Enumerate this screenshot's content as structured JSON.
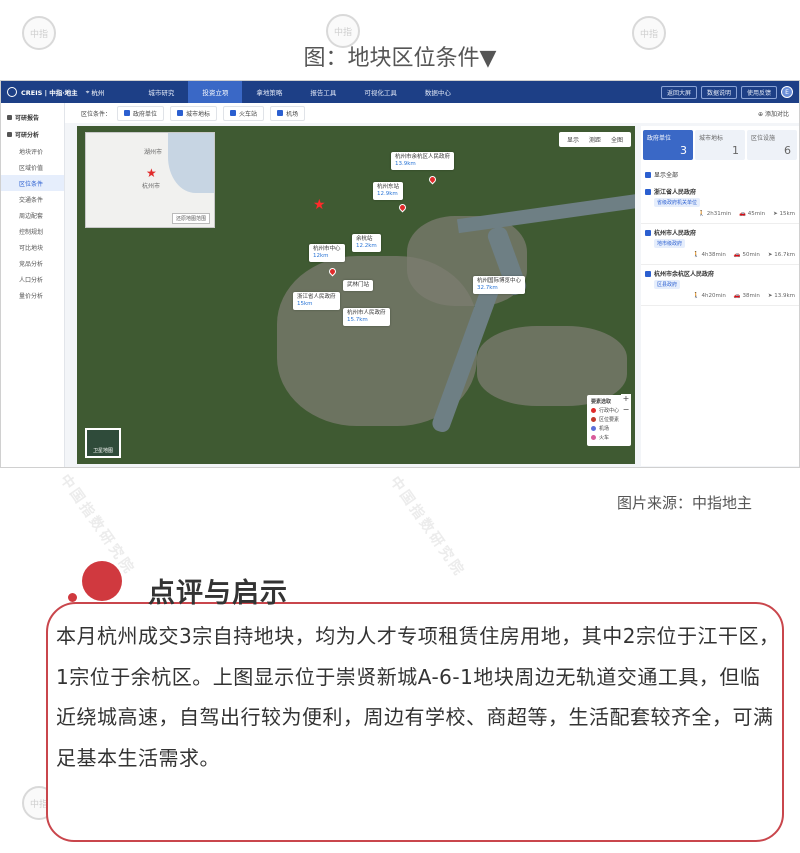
{
  "figure_title": "图：地块区位条件▼",
  "watermark": {
    "seal_text": "中指",
    "diagonal_text": "中国指数研究院"
  },
  "app": {
    "logo": "CREIS | 中指·地主",
    "city": "杭州",
    "nav": [
      "城市研究",
      "投资立项",
      "拿地策略",
      "报告工具",
      "可视化工具",
      "数据中心"
    ],
    "nav_active_index": 1,
    "top_buttons": [
      "返回大屏",
      "数据说明",
      "使用反馈"
    ],
    "avatar": "E",
    "sidebar": {
      "group1": "可研报告",
      "group2": "可研分析",
      "items": [
        "地块评价",
        "区域价值",
        "区位条件",
        "交通条件",
        "周边配套",
        "控制规划",
        "可比地块",
        "竞品分析",
        "人口分析",
        "量价分析"
      ],
      "active_index": 2
    },
    "filter": {
      "label": "区位条件：",
      "chips": [
        "政府单位",
        "城市地标",
        "火车站",
        "机场"
      ],
      "right": "添加对比"
    },
    "map": {
      "tools": [
        "显示",
        "测距",
        "全图"
      ],
      "inset": {
        "city_label": "杭州市",
        "north_label": "湖州市",
        "btn": "还原地图范围"
      },
      "pois": [
        {
          "name": "杭州市余杭区人民政府",
          "dist": "13.9km"
        },
        {
          "name": "杭州东站",
          "dist": "12.9km"
        },
        {
          "name": "余杭站",
          "dist": "12.2km"
        },
        {
          "name": "杭州市中心",
          "dist": "12km"
        },
        {
          "name": "杭州国际博览中心",
          "dist": "32.7km"
        },
        {
          "name": "浙江省人民政府",
          "dist": "15km"
        },
        {
          "name": "武林门站",
          "dist": ""
        },
        {
          "name": "杭州市人民政府",
          "dist": "15.7km"
        }
      ],
      "legend": {
        "title": "要素选取",
        "rows": [
          "行政中心",
          "区位要素",
          "机场",
          "火车"
        ]
      },
      "sat_thumb": "卫星地图"
    },
    "right_panel": {
      "tabs": [
        {
          "label": "政府单位",
          "count": "3"
        },
        {
          "label": "城市地标",
          "count": "1"
        },
        {
          "label": "区位设施",
          "count": "6"
        }
      ],
      "show_all": "显示全部",
      "cards": [
        {
          "title": "浙江省人民政府",
          "tag": "省级政府机关单位",
          "m1": "2h31min",
          "m2": "45min",
          "m3": "15km"
        },
        {
          "title": "杭州市人民政府",
          "tag": "地市级政府",
          "m1": "4h38min",
          "m2": "50min",
          "m3": "16.7km"
        },
        {
          "title": "杭州市余杭区人民政府",
          "tag": "区县政府",
          "m1": "4h20min",
          "m2": "38min",
          "m3": "13.9km"
        }
      ]
    }
  },
  "caption": "图片来源：中指地主",
  "section_title": "点评与启示",
  "comment": "本月杭州成交3宗自持地块，均为人才专项租赁住房用地，其中2宗位于江干区，1宗位于余杭区。上图显示位于崇贤新城A-6-1地块周边无轨道交通工具，但临近绕城高速，自驾出行较为便利，周边有学校、商超等，生活配套较齐全，可满足基本生活需求。",
  "colors": {
    "nav_bg": "#1d3f86",
    "accent_red": "#d0393f",
    "link_blue": "#2b5fd0"
  }
}
